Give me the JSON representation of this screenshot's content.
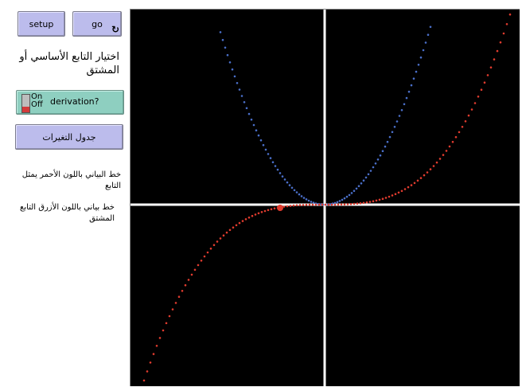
{
  "buttons": {
    "setup_label": "setup",
    "go_label": "go",
    "go_forever_icon": "forever-arrows-icon",
    "table_label": "جدول التغيرات"
  },
  "choose_label": "اختيار التابع الأساسي أو المشتق",
  "switch": {
    "on_label": "On",
    "off_label": "Off",
    "name": "derivation?",
    "state": "off"
  },
  "notes": {
    "red_curve": "خط البياني باللون الأحمر يمثل التابع",
    "blue_curve": "خط بياني باللون الأزرق التابع المشتق"
  },
  "colors": {
    "function_curve": "#e03b2e",
    "derivative_curve": "#4a6fc9",
    "axes": "#ffffff",
    "background": "#000000"
  }
}
